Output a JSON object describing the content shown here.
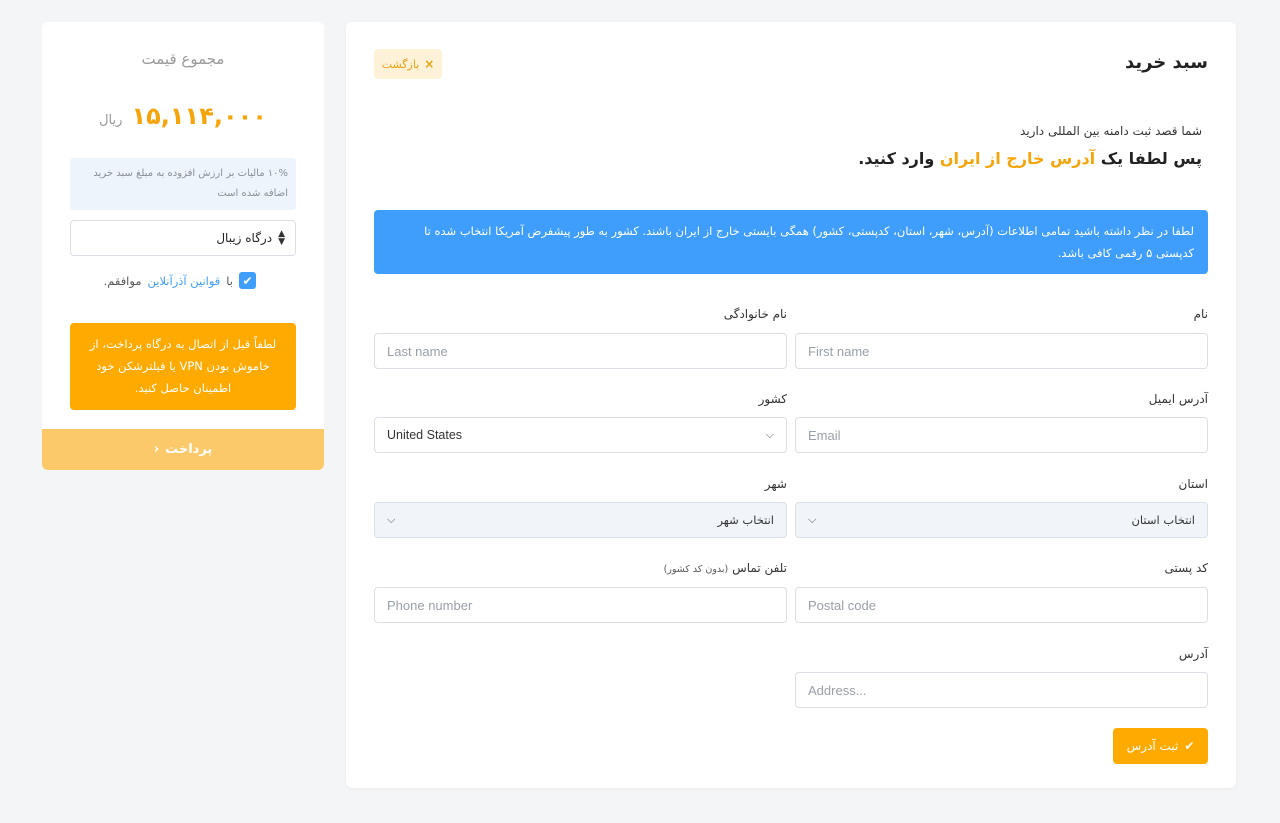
{
  "cart": {
    "title": "سبد خرید",
    "back_label": "بازگشت",
    "back_icon": "×",
    "intro_line1": "شما قصد ثبت دامنه بین المللی دارید",
    "intro_line2_prefix": "پس لطفا یک",
    "intro_line2_highlight": "آدرس خارج از ایران",
    "intro_line2_suffix": "وارد کنید.",
    "info_text": "لطفا در نظر داشته باشید تمامی اطلاعات (آدرس، شهر، استان، کدپستی، کشور) همگی بایستی خارج از ایران باشند. کشور به طور پیشفرض آمریکا انتخاب شده تا کدپستی ۵ رقمی کافی باشد."
  },
  "form": {
    "first_name": {
      "label": "نام",
      "placeholder": "First name",
      "value": ""
    },
    "last_name": {
      "label": "نام خانوادگی",
      "placeholder": "Last name",
      "value": ""
    },
    "email": {
      "label": "آدرس ایمیل",
      "placeholder": "Email",
      "value": ""
    },
    "country": {
      "label": "کشور",
      "value": "United States"
    },
    "state": {
      "label": "استان",
      "value": "انتخاب استان"
    },
    "city": {
      "label": "شهر",
      "value": "انتخاب شهر"
    },
    "postal_code": {
      "label": "کد پستی",
      "placeholder": "Postal code",
      "value": ""
    },
    "phone": {
      "label": "تلفن تماس",
      "label_note": "(بدون کد کشور)",
      "placeholder": "Phone number",
      "value": ""
    },
    "address": {
      "label": "آدرس",
      "placeholder": "Address...",
      "value": ""
    },
    "submit_label": "ثبت آدرس",
    "submit_icon": "✔"
  },
  "sidebar": {
    "title": "مجموع قیمت",
    "price": "۱۵,۱۱۴,۰۰۰",
    "currency": "ریال",
    "tax_note": "۱۰% مالیات بر ارزش افزوده به مبلغ سبد خرید اضافه شده است",
    "gateway": "درگاه زیبال",
    "terms_prefix": "با",
    "terms_link": "قوانین آذرآنلاین",
    "terms_suffix": "موافقم.",
    "terms_checked": true,
    "vpn_warning": "لطفاً قبل از اتصال به درگاه پرداخت، از خاموش بودن VPN یا فیلترشکن خود اطمینان حاصل کنید.",
    "pay_label": "پرداخت",
    "pay_icon": "‹"
  },
  "colors": {
    "accent": "#ffaa00",
    "highlight": "#f5a40a",
    "info": "#3f9efc",
    "background": "#f4f5f7"
  }
}
